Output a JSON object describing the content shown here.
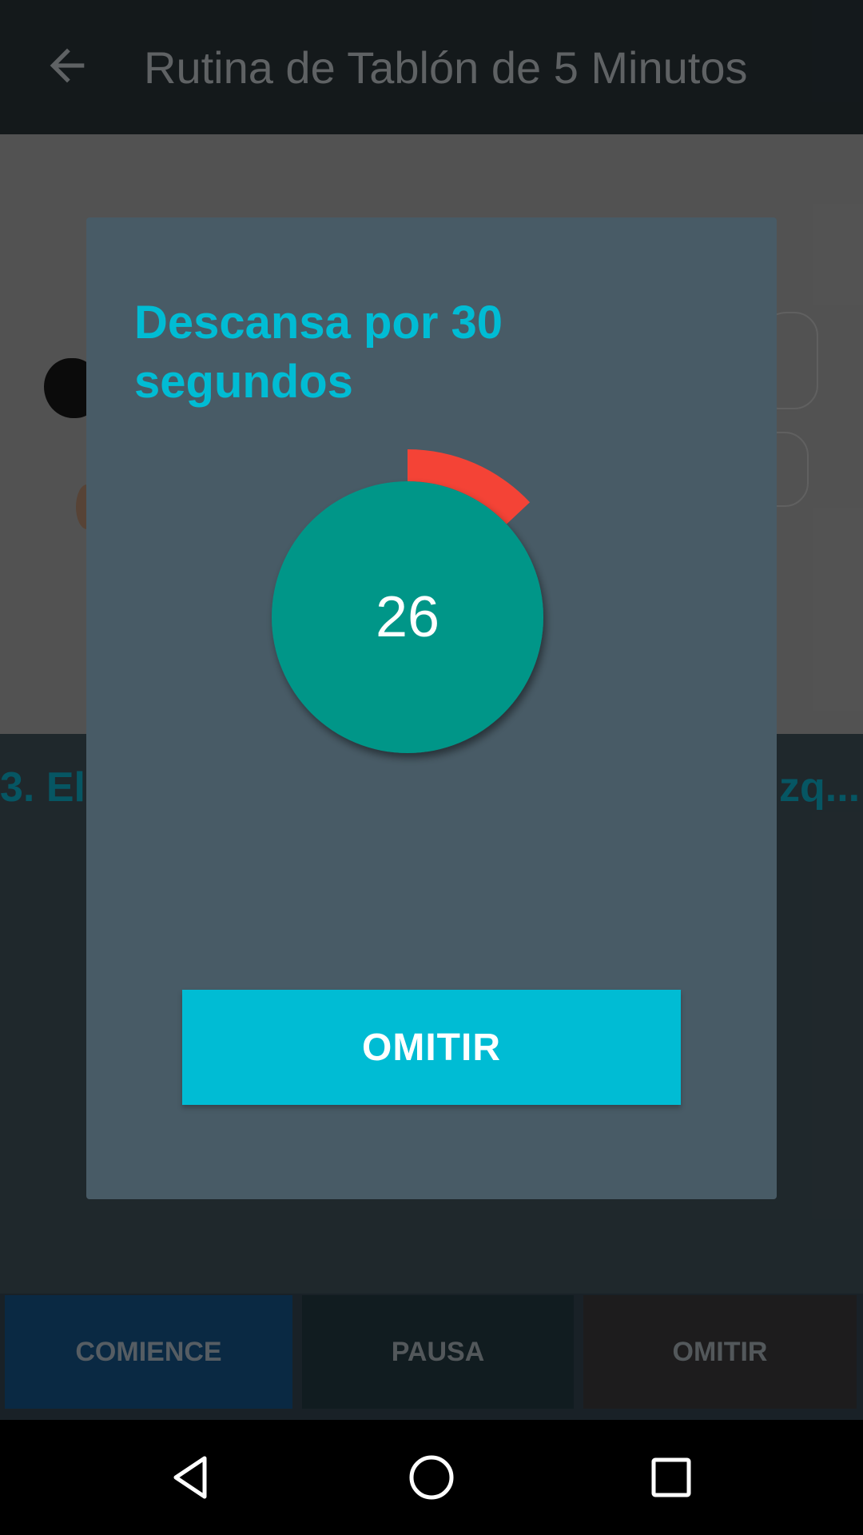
{
  "appbar": {
    "title": "Rutina de Tablón de 5 Minutos"
  },
  "exercise": {
    "title_left": "3. El",
    "title_right": "zq..."
  },
  "bottom_buttons": {
    "start_label": "COMIENCE",
    "pause_label": "PAUSA",
    "skip_label": "OMITIR"
  },
  "dialog": {
    "title": "Descansa por 30 segundos",
    "countdown": "26",
    "elapsed_fraction": 0.13,
    "skip_label": "OMITIR"
  },
  "colors": {
    "accent": "#00bcd4",
    "timer_circle": "#009688",
    "timer_arc": "#f44336",
    "dialog_bg": "#485b66"
  },
  "icons": {
    "back": "arrow-left-icon",
    "nav_back": "triangle-back-icon",
    "nav_home": "circle-home-icon",
    "nav_recents": "square-recents-icon"
  }
}
